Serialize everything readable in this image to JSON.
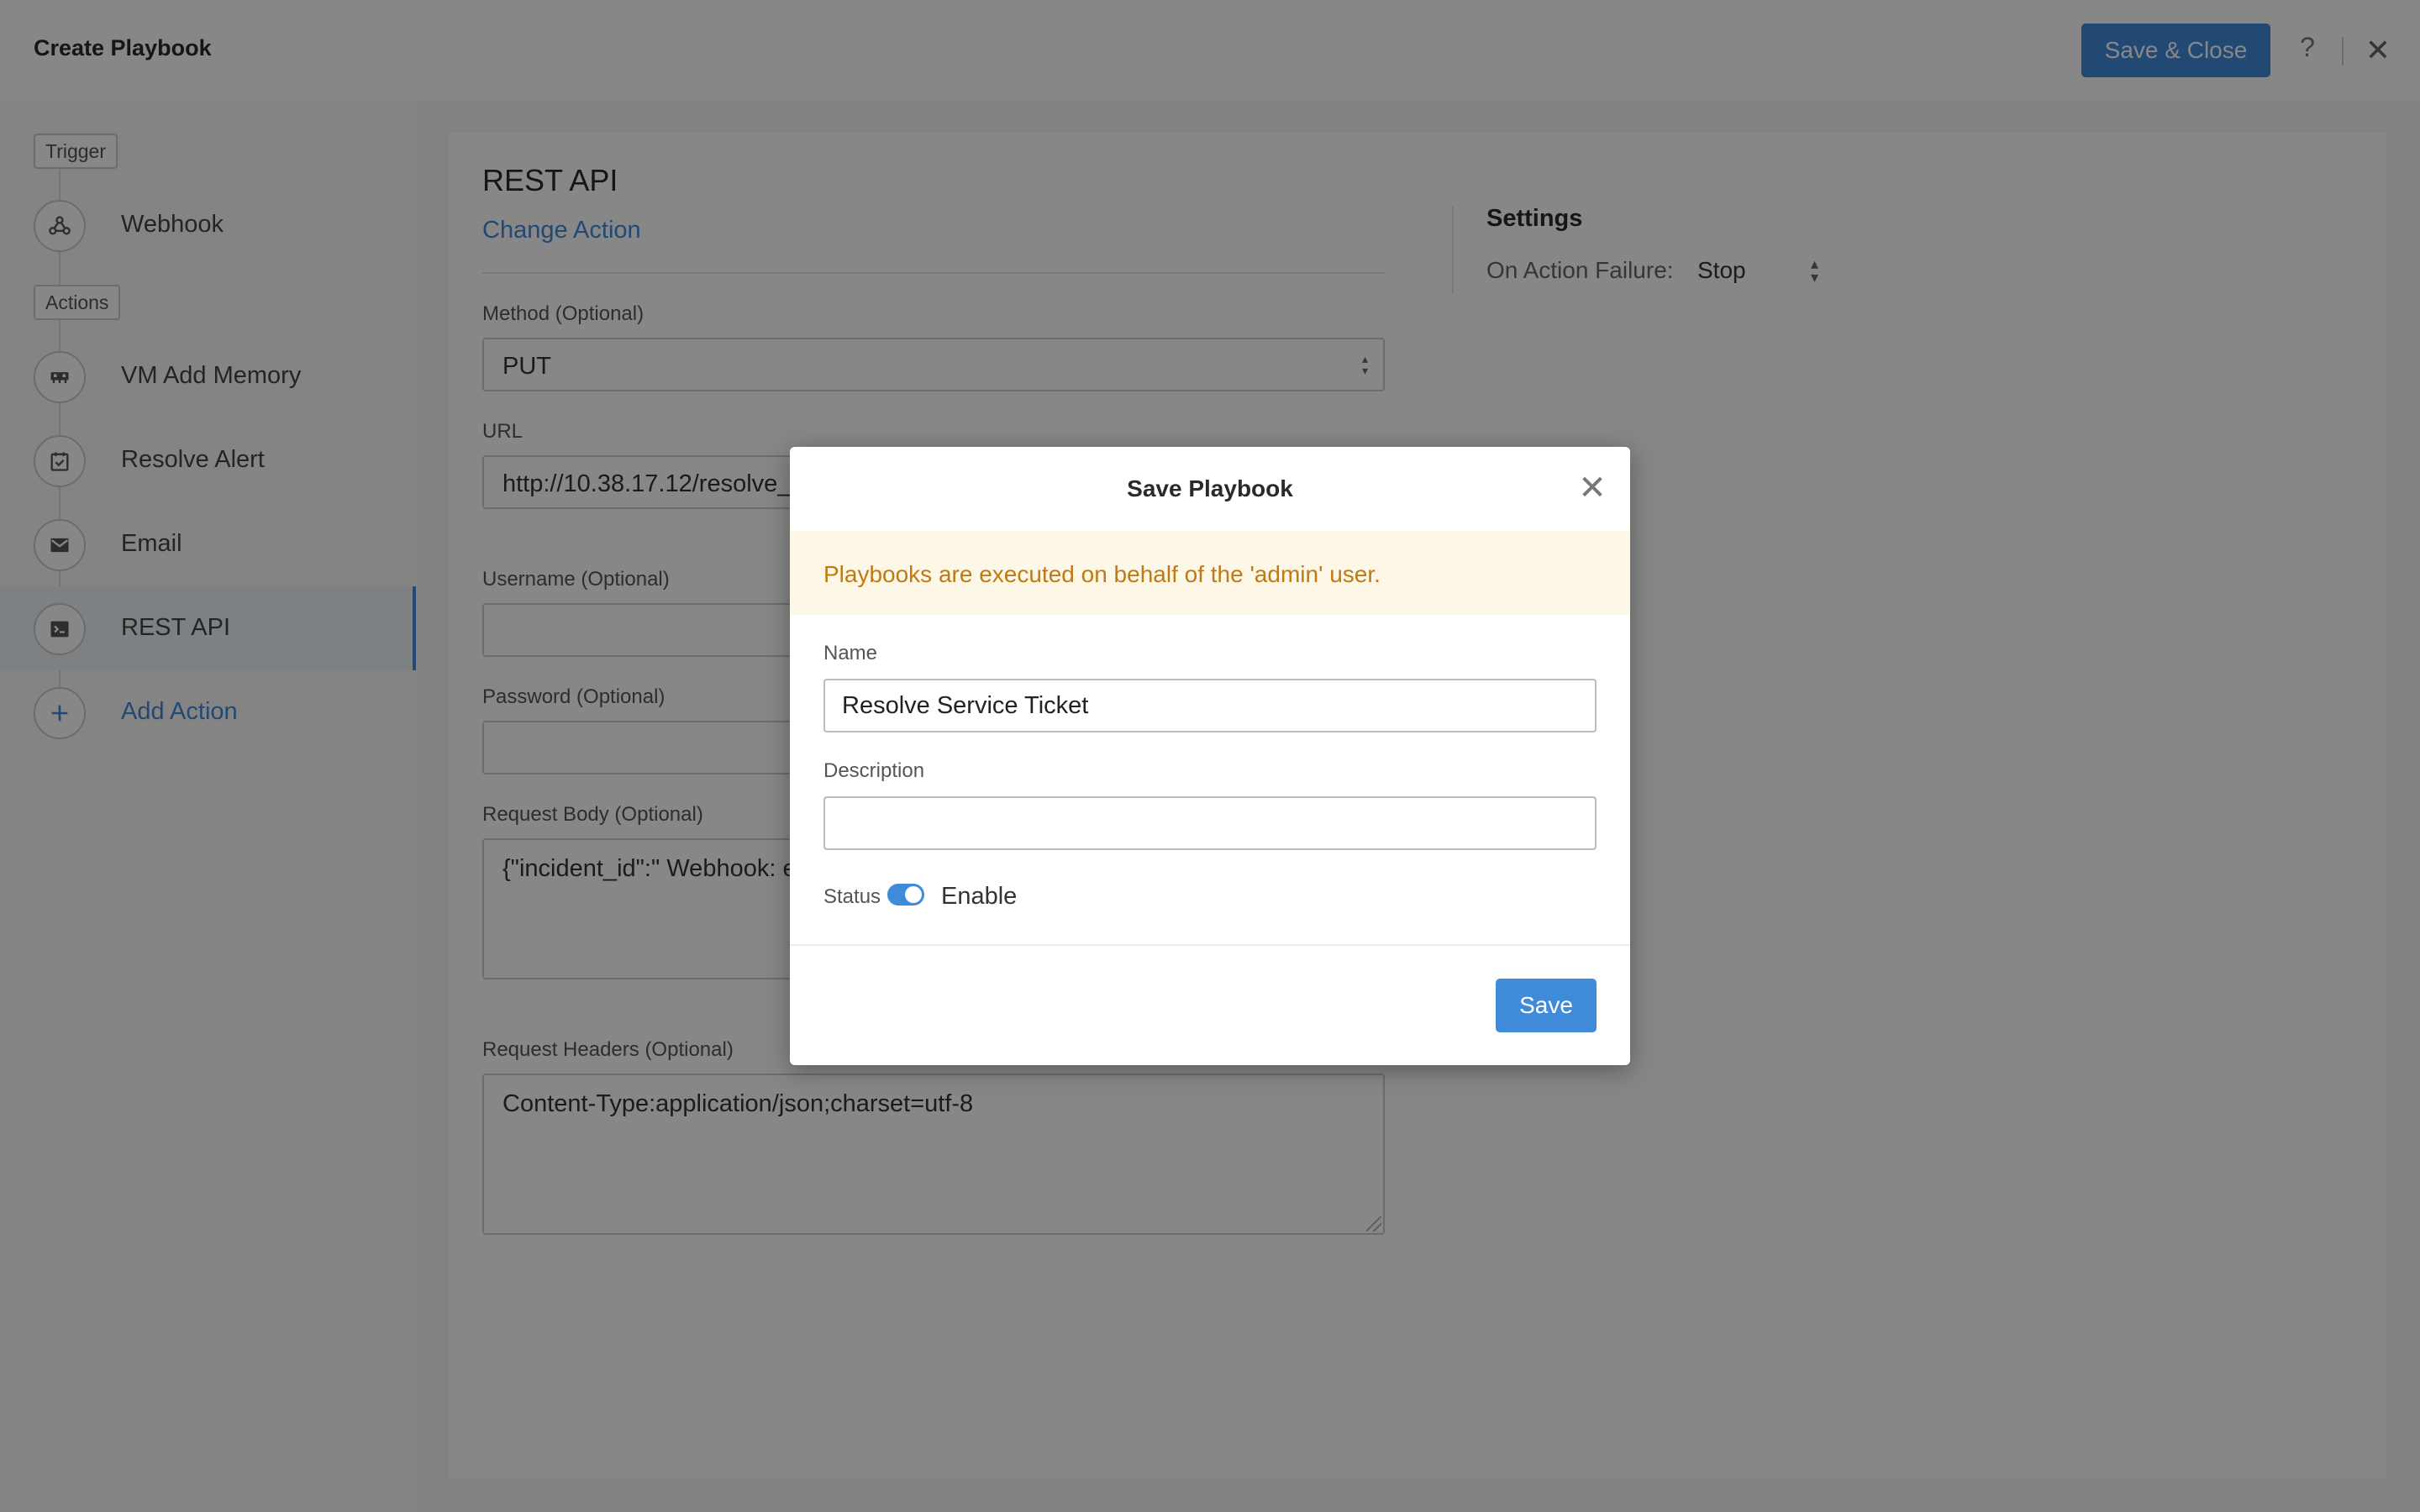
{
  "header": {
    "title": "Create Playbook",
    "save_close_label": "Save & Close",
    "help_glyph": "?",
    "close_glyph": "✕"
  },
  "sidebar": {
    "trigger_tag": "Trigger",
    "actions_tag": "Actions",
    "items": [
      {
        "label": "Webhook",
        "icon": "webhook-icon"
      },
      {
        "label": "VM Add Memory",
        "icon": "memory-icon"
      },
      {
        "label": "Resolve Alert",
        "icon": "resolve-alert-icon"
      },
      {
        "label": "Email",
        "icon": "email-icon"
      },
      {
        "label": "REST API",
        "icon": "terminal-icon",
        "active": true
      },
      {
        "label": "Add Action",
        "icon": "plus-icon"
      }
    ]
  },
  "action": {
    "title": "REST API",
    "change_action": "Change Action",
    "method_label": "Method (Optional)",
    "method_value": "PUT",
    "url_label": "URL",
    "url_value": "http://10.38.17.12/resolve_tick",
    "username_label": "Username (Optional)",
    "password_label": "Password (Optional)",
    "body_label": "Request Body (Optional)",
    "body_value": "{\"incident_id\":\" Webhook: er",
    "headers_label": "Request Headers (Optional)",
    "headers_value": "Content-Type:application/json;charset=utf-8"
  },
  "settings": {
    "title": "Settings",
    "failure_label": "On Action Failure:",
    "failure_value": "Stop"
  },
  "modal": {
    "title": "Save Playbook",
    "close_glyph": "✕",
    "warning": "Playbooks are executed on behalf of the 'admin' user.",
    "name_label": "Name",
    "name_value": "Resolve Service Ticket",
    "description_label": "Description",
    "description_value": "",
    "status_label": "Status",
    "status_text": "Enable",
    "status_enabled": true,
    "save_label": "Save"
  },
  "colors": {
    "accent": "#3f8bd9",
    "warning_bg": "#fdf7e8",
    "warning_text": "#c07a12"
  }
}
